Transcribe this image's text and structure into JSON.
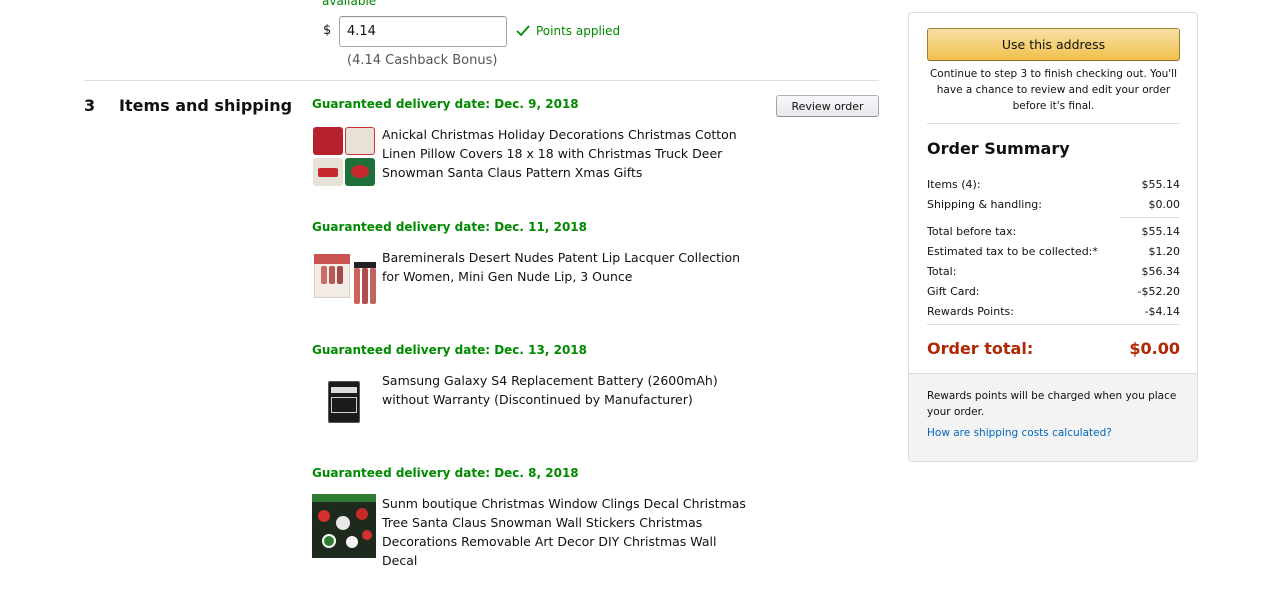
{
  "payment": {
    "available_text": "available",
    "currency_symbol": "$",
    "points_value": "4.14",
    "points_applied": "Points applied",
    "cashback_text": "(4.14  Cashback Bonus)"
  },
  "step": {
    "number": "3",
    "title": "Items and shipping",
    "review_button": "Review order"
  },
  "shipments": [
    {
      "delivery": "Guaranteed delivery date: Dec. 9, 2018",
      "item_title": "Anickal Christmas Holiday Decorations Christmas Cotton Linen Pillow Covers 18 x 18 with Christmas Truck Deer Snowman Santa Claus Pattern Xmas Gifts"
    },
    {
      "delivery": "Guaranteed delivery date: Dec. 11, 2018",
      "item_title": "Bareminerals Desert Nudes Patent Lip Lacquer Collection for Women, Mini Gen Nude Lip, 3 Ounce"
    },
    {
      "delivery": "Guaranteed delivery date: Dec. 13, 2018",
      "item_title": "Samsung Galaxy S4 Replacement Battery (2600mAh) without Warranty (Discontinued by Manufacturer)"
    },
    {
      "delivery": "Guaranteed delivery date: Dec. 8, 2018",
      "item_title": "Sunm boutique Christmas Window Clings Decal Christmas Tree Santa Claus Snowman Wall Stickers Christmas Decorations Removable Art Decor DIY Christmas Wall Decal"
    }
  ],
  "summary": {
    "use_address_button": "Use this address",
    "continue_note": "Continue to step 3 to finish checking out. You'll have a chance to review and edit your order before it's final.",
    "title": "Order Summary",
    "rows": [
      {
        "label": "Items (4):",
        "value": "$55.14"
      },
      {
        "label": "Shipping & handling:",
        "value": "$0.00"
      },
      {
        "label": "Total before tax:",
        "value": "$55.14"
      },
      {
        "label": "Estimated tax to be collected:*",
        "value": "$1.20"
      },
      {
        "label": "Total:",
        "value": "$56.34"
      },
      {
        "label": "Gift Card:",
        "value": "-$52.20"
      },
      {
        "label": "Rewards Points:",
        "value": "-$4.14"
      }
    ],
    "order_total_label": "Order total:",
    "order_total_value": "$0.00",
    "footer_note": "Rewards points will be charged when you place your order.",
    "footer_link": "How are shipping costs calculated?"
  },
  "colors": {
    "green": "#008a00",
    "price_red": "#b12704",
    "link_blue": "#0066c0",
    "button_gold": "#f0c14b"
  }
}
